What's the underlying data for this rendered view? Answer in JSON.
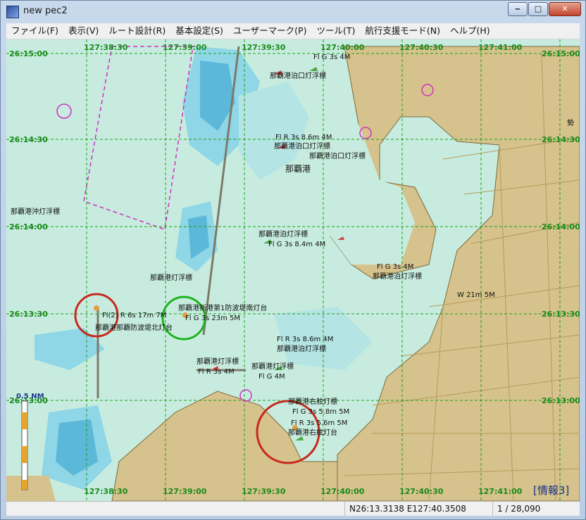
{
  "window": {
    "title": "new pec2"
  },
  "window_buttons": {
    "minimize": "‒",
    "maximize": "□",
    "close": "✕"
  },
  "menu": [
    "ファイル(F)",
    "表示(V)",
    "ルート設計(R)",
    "基本設定(S)",
    "ユーザーマーク(P)",
    "ツール(T)",
    "航行支援モード(N)",
    "ヘルプ(H)"
  ],
  "chart": {
    "top_longitudes": [
      "127:38:30",
      "127:39:00",
      "127:39:30",
      "127:40:00",
      "127:40:30",
      "127:41:00"
    ],
    "bottom_longitudes": [
      "127:38:30",
      "127:39:00",
      "127:39:30",
      "127:40:00",
      "127:40:30",
      "127:41:00"
    ],
    "left_latitudes": [
      "26:15:00",
      "26:14:30",
      "26:14:00",
      "26:13:30",
      "26:13:00"
    ],
    "right_latitudes": [
      "26:15:00",
      "26:14:30",
      "26:14:00",
      "26:13:30",
      "26:13:00"
    ],
    "scale_label": "0.5 NM",
    "info_label": "[情報3]",
    "port_name": "那覇港",
    "labels": [
      "那覇港泊口灯浮標",
      "Fl R 3s 8.6m 4M",
      "那覇港泊口灯浮標",
      "Fl G 3s 4M",
      "那覇港泊口灯浮標",
      "那覇港沖灯浮標",
      "那覇港泊灯浮標",
      "Fl G 3s 8.4m 4M",
      "那覇港灯浮標",
      "Fl G 3s 4M",
      "那覇港泊灯浮標",
      "W 21m 5M",
      "Fl(2) R 6s 17m 7M",
      "那覇港那覇防波堤北灯台",
      "那覇港新港第1防波堤南灯台",
      "Fl G 3s 23m 5M",
      "Fl R 3s 8.6m 4M",
      "那覇港泊灯浮標",
      "那覇港灯浮標",
      "Fl R 3s 4M",
      "那覇港灯浮標",
      "Fl G 4M",
      "那覇港右舷灯標",
      "Fl G 3s 5.8m 5M",
      "Fl R 3s 5.6m 5M",
      "那覇港右舷灯台",
      "勢"
    ],
    "colors": {
      "water": "#c7ecdf",
      "shallow": "#8fd6e6",
      "deep": "#5bb8d9",
      "land": "#d6c28c",
      "grid": "#1aa31a",
      "highlight_red": "#c8281e",
      "highlight_green": "#1fb31f",
      "restricted": "#d030c0"
    }
  },
  "status": {
    "position": "N26:13.3138 E127:40.3508",
    "scale": "1 / 28,090"
  }
}
